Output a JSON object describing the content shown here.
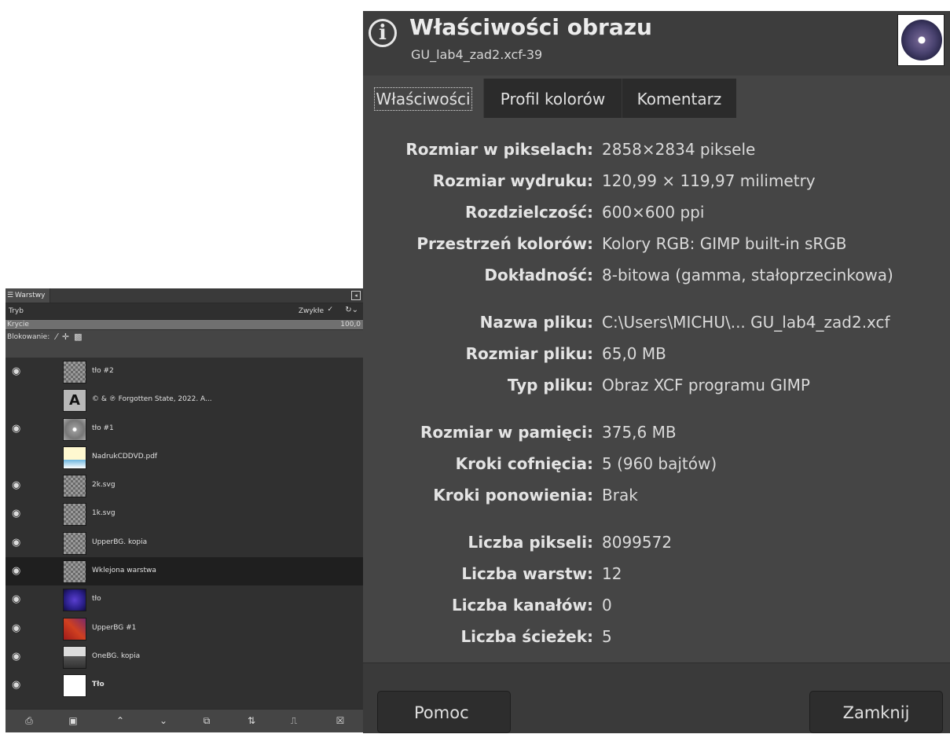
{
  "layers_panel": {
    "tab_label": "Warstwy",
    "mode_label": "Tryb",
    "mode_value": "Zwykłe",
    "opacity_label": "Krycie",
    "opacity_value": "100,0",
    "opacity_fraction": 1.0,
    "lock_label": "Blokowanie:",
    "layers": [
      {
        "name": "tło #2",
        "visible": true,
        "thumb": "checker",
        "selected": false
      },
      {
        "name": "© & ℗ Forgotten State, 2022. A...",
        "visible": false,
        "thumb": "text",
        "selected": false
      },
      {
        "name": "tło #1",
        "visible": true,
        "thumb": "disc",
        "selected": false
      },
      {
        "name": "NadrukCDDVD.pdf",
        "visible": false,
        "thumb": "pdf",
        "selected": false
      },
      {
        "name": "2k.svg",
        "visible": true,
        "thumb": "checker",
        "selected": false
      },
      {
        "name": "1k.svg",
        "visible": true,
        "thumb": "checker",
        "selected": false
      },
      {
        "name": "UpperBG. kopia",
        "visible": true,
        "thumb": "checker",
        "selected": false
      },
      {
        "name": "Wklejona warstwa",
        "visible": true,
        "thumb": "checker",
        "selected": true
      },
      {
        "name": "tło",
        "visible": true,
        "thumb": "blue",
        "selected": false
      },
      {
        "name": "UpperBG #1",
        "visible": true,
        "thumb": "red",
        "selected": false
      },
      {
        "name": "OneBG. kopia",
        "visible": true,
        "thumb": "photo",
        "selected": false
      },
      {
        "name": "Tło",
        "visible": true,
        "thumb": "white",
        "selected": false,
        "bold": true
      }
    ],
    "bottom_icons": [
      "new-layer-icon",
      "new-group-icon",
      "raise-layer-icon",
      "lower-layer-icon",
      "duplicate-layer-icon",
      "anchor-layer-icon",
      "mask-layer-icon",
      "delete-layer-icon"
    ]
  },
  "dialog": {
    "title": "Właściwości obrazu",
    "subtitle": "GU_lab4_zad2.xcf-39",
    "tabs": [
      "Właściwości",
      "Profil kolorów",
      "Komentarz"
    ],
    "active_tab": 0,
    "fields": [
      {
        "label": "Rozmiar w pikselach:",
        "value": "2858×2834 piksele"
      },
      {
        "label": "Rozmiar wydruku:",
        "value": "120,99 × 119,97 milimetry"
      },
      {
        "label": "Rozdzielczość:",
        "value": "600×600 ppi"
      },
      {
        "label": "Przestrzeń kolorów:",
        "value": "Kolory RGB: GIMP built-in sRGB"
      },
      {
        "label": "Dokładność:",
        "value": "8-bitowa (gamma, stałoprzecinkowa)"
      },
      {
        "label": "Nazwa pliku:",
        "value": "C:\\Users\\MICHU\\... GU_lab4_zad2.xcf"
      },
      {
        "label": "Rozmiar pliku:",
        "value": "65,0 MB"
      },
      {
        "label": "Typ pliku:",
        "value": "Obraz XCF programu GIMP"
      },
      {
        "label": "Rozmiar w pamięci:",
        "value": "375,6 MB"
      },
      {
        "label": "Kroki cofnięcia:",
        "value": "5 (960 bajtów)"
      },
      {
        "label": "Kroki ponowienia:",
        "value": "Brak"
      },
      {
        "label": "Liczba pikseli:",
        "value": "8099572"
      },
      {
        "label": "Liczba warstw:",
        "value": "12"
      },
      {
        "label": "Liczba kanałów:",
        "value": "0"
      },
      {
        "label": "Liczba ścieżek:",
        "value": "5"
      }
    ],
    "help_button": "Pomoc",
    "close_button": "Zamknij"
  }
}
